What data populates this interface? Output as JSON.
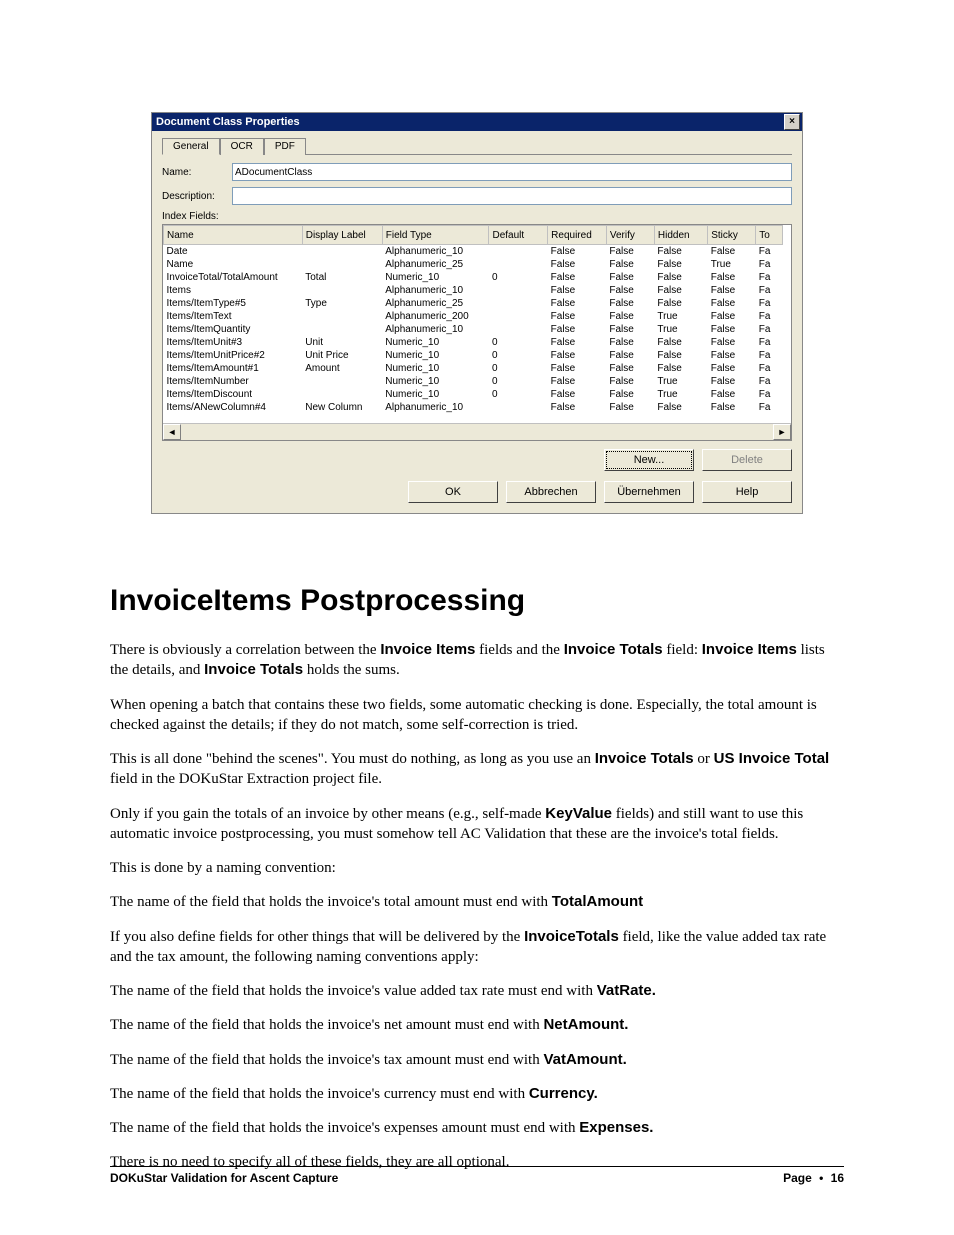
{
  "dialog": {
    "title": "Document Class Properties",
    "close_glyph": "×",
    "tabs": [
      "General",
      "OCR",
      "PDF"
    ],
    "active_tab": 0,
    "name_label": "Name:",
    "name_value": "ADocumentClass",
    "description_label": "Description:",
    "description_value": "",
    "index_fields_label": "Index Fields:",
    "columns": [
      "Name",
      "Display Label",
      "Field Type",
      "Default",
      "Required",
      "Verify",
      "Hidden",
      "Sticky",
      "To"
    ],
    "rows": [
      {
        "name": "Date",
        "label": "",
        "ftype": "Alphanumeric_10",
        "def": "",
        "req": "False",
        "ver": "False",
        "hid": "False",
        "sticky": "False",
        "to": "Fa"
      },
      {
        "name": "Name",
        "label": "",
        "ftype": "Alphanumeric_25",
        "def": "",
        "req": "False",
        "ver": "False",
        "hid": "False",
        "sticky": "True",
        "to": "Fa"
      },
      {
        "name": "InvoiceTotal/TotalAmount",
        "label": "Total",
        "ftype": "Numeric_10",
        "def": "0",
        "req": "False",
        "ver": "False",
        "hid": "False",
        "sticky": "False",
        "to": "Fa"
      },
      {
        "name": "Items",
        "label": "",
        "ftype": "Alphanumeric_10",
        "def": "",
        "req": "False",
        "ver": "False",
        "hid": "False",
        "sticky": "False",
        "to": "Fa"
      },
      {
        "name": "Items/ItemType#5",
        "label": "Type",
        "ftype": "Alphanumeric_25",
        "def": "",
        "req": "False",
        "ver": "False",
        "hid": "False",
        "sticky": "False",
        "to": "Fa"
      },
      {
        "name": "Items/ItemText",
        "label": "",
        "ftype": "Alphanumeric_200",
        "def": "",
        "req": "False",
        "ver": "False",
        "hid": "True",
        "sticky": "False",
        "to": "Fa"
      },
      {
        "name": "Items/ItemQuantity",
        "label": "",
        "ftype": "Alphanumeric_10",
        "def": "",
        "req": "False",
        "ver": "False",
        "hid": "True",
        "sticky": "False",
        "to": "Fa"
      },
      {
        "name": "Items/ItemUnit#3",
        "label": "Unit",
        "ftype": "Numeric_10",
        "def": "0",
        "req": "False",
        "ver": "False",
        "hid": "False",
        "sticky": "False",
        "to": "Fa"
      },
      {
        "name": "Items/ItemUnitPrice#2",
        "label": "Unit Price",
        "ftype": "Numeric_10",
        "def": "0",
        "req": "False",
        "ver": "False",
        "hid": "False",
        "sticky": "False",
        "to": "Fa"
      },
      {
        "name": "Items/ItemAmount#1",
        "label": "Amount",
        "ftype": "Numeric_10",
        "def": "0",
        "req": "False",
        "ver": "False",
        "hid": "False",
        "sticky": "False",
        "to": "Fa"
      },
      {
        "name": "Items/ItemNumber",
        "label": "",
        "ftype": "Numeric_10",
        "def": "0",
        "req": "False",
        "ver": "False",
        "hid": "True",
        "sticky": "False",
        "to": "Fa"
      },
      {
        "name": "Items/ItemDiscount",
        "label": "",
        "ftype": "Numeric_10",
        "def": "0",
        "req": "False",
        "ver": "False",
        "hid": "True",
        "sticky": "False",
        "to": "Fa"
      },
      {
        "name": "Items/ANewColumn#4",
        "label": "New Column",
        "ftype": "Alphanumeric_10",
        "def": "",
        "req": "False",
        "ver": "False",
        "hid": "False",
        "sticky": "False",
        "to": "Fa"
      }
    ],
    "new_btn": "New...",
    "delete_btn": "Delete",
    "ok_btn": "OK",
    "cancel_btn": "Abbrechen",
    "apply_btn": "Übernehmen",
    "help_btn": "Help"
  },
  "article": {
    "heading": "InvoiceItems Postprocessing",
    "p1_a": "There is obviously a correlation between the ",
    "p1_b1": "Invoice Items",
    "p1_c": " fields and the ",
    "p1_b2": "Invoice Totals",
    "p1_d": " field: ",
    "p1_b3": "Invoice Items",
    "p1_e": " lists the details, and ",
    "p1_b4": "Invoice Totals",
    "p1_f": " holds the sums.",
    "p2": "When opening a batch that contains these two fields, some automatic checking is done. Especially, the total amount is checked against the details; if they do not match, some self-correction is tried.",
    "p3_a": "This is all done \"behind the scenes\".  You must do nothing, as long as you use an ",
    "p3_b1": "Invoice Totals",
    "p3_b": " or ",
    "p3_b2": "US Invoice Total",
    "p3_c": " field in the DOKuStar Extraction project file.",
    "p4_a": "Only if you gain the totals of an invoice by other means (e.g., self-made ",
    "p4_b1": "KeyValue",
    "p4_b": " fields) and still want to use this automatic invoice postprocessing, you must somehow tell AC Validation that these are the invoice's total fields.",
    "p5": "This is done by a naming convention:",
    "p6_a": "The name of the field that holds the invoice's total amount must end with ",
    "p6_b": "TotalAmount",
    "p7_a": "If you also define fields for other things that will be delivered by the ",
    "p7_b1": "InvoiceTotals",
    "p7_b": " field, like  the value added tax rate and the tax amount, the following naming conventions apply:",
    "p8_a": "The name of the field that holds the invoice's value added tax rate must end with ",
    "p8_b": "VatRate.",
    "p9_a": "The name of the field that holds the invoice's net amount must end with ",
    "p9_b": "NetAmount.",
    "p10_a": "The name of the field that holds the invoice's tax amount must end with ",
    "p10_b": "VatAmount.",
    "p11_a": "The name of the field that holds the invoice's currency must end with ",
    "p11_b": "Currency.",
    "p12_a": "The name of the field that holds the invoice's expenses amount must end with ",
    "p12_b": "Expenses.",
    "p13": "There is no need to specify all of these fields, they are all optional."
  },
  "footer": {
    "left": "DOKuStar Validation for Ascent Capture",
    "right_label": "Page",
    "right_bullet": "•",
    "right_num": "16"
  }
}
